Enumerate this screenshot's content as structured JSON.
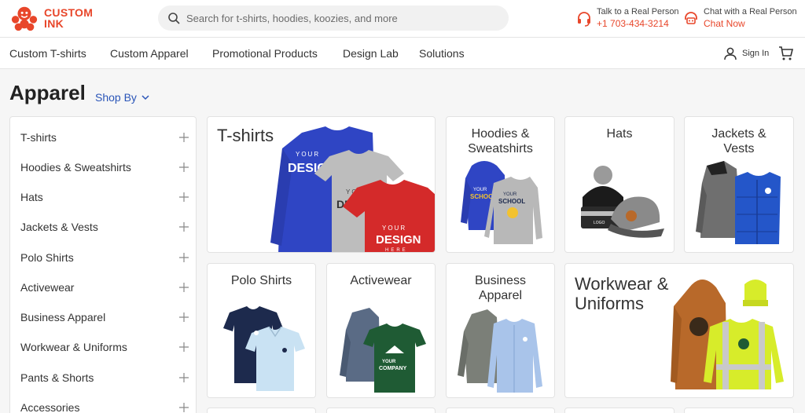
{
  "header": {
    "logo_line1": "CUSTOM",
    "logo_line2": "INK",
    "search_placeholder": "Search for t-shirts, hoodies, koozies, and more",
    "talk_label": "Talk to a Real Person",
    "phone": "+1 703-434-3214",
    "chat_label": "Chat with a Real Person",
    "chat_link": "Chat Now"
  },
  "nav": {
    "items": [
      "Custom T-shirts",
      "Custom Apparel",
      "Promotional Products",
      "Design Lab",
      "Solutions"
    ],
    "signin": "Sign In"
  },
  "page": {
    "title": "Apparel",
    "shop_by": "Shop By"
  },
  "sidebar": {
    "items": [
      "T-shirts",
      "Hoodies & Sweatshirts",
      "Hats",
      "Jackets & Vests",
      "Polo Shirts",
      "Activewear",
      "Business Apparel",
      "Workwear & Uniforms",
      "Pants & Shorts",
      "Accessories"
    ]
  },
  "cards": {
    "tshirts": "T-shirts",
    "hoodies_line1": "Hoodies &",
    "hoodies_line2": "Sweatshirts",
    "hats": "Hats",
    "jackets_line1": "Jackets &",
    "jackets_line2": "Vests",
    "polo": "Polo Shirts",
    "activewear": "Activewear",
    "business_line1": "Business",
    "business_line2": "Apparel",
    "workwear_line1": "Workwear &",
    "workwear_line2": "Uniforms"
  },
  "art_text": {
    "your": "YOUR",
    "design": "DESIGN",
    "here": "HERE",
    "school": "SCHOOL",
    "company": "COMPANY",
    "logo": "LOGO"
  },
  "colors": {
    "brand": "#e8462a",
    "link": "#2a55b8",
    "royal": "#2f45c4",
    "red": "#d42a2a",
    "grey": "#bdbdbd",
    "navy": "#1d2a4d",
    "green": "#1f5b34",
    "safety": "#d7ec2a",
    "brown": "#b8692a"
  },
  "icons": [
    "search-icon",
    "headset-icon",
    "chat-icon",
    "user-icon",
    "cart-icon",
    "chevron-down-icon",
    "plus-icon"
  ]
}
